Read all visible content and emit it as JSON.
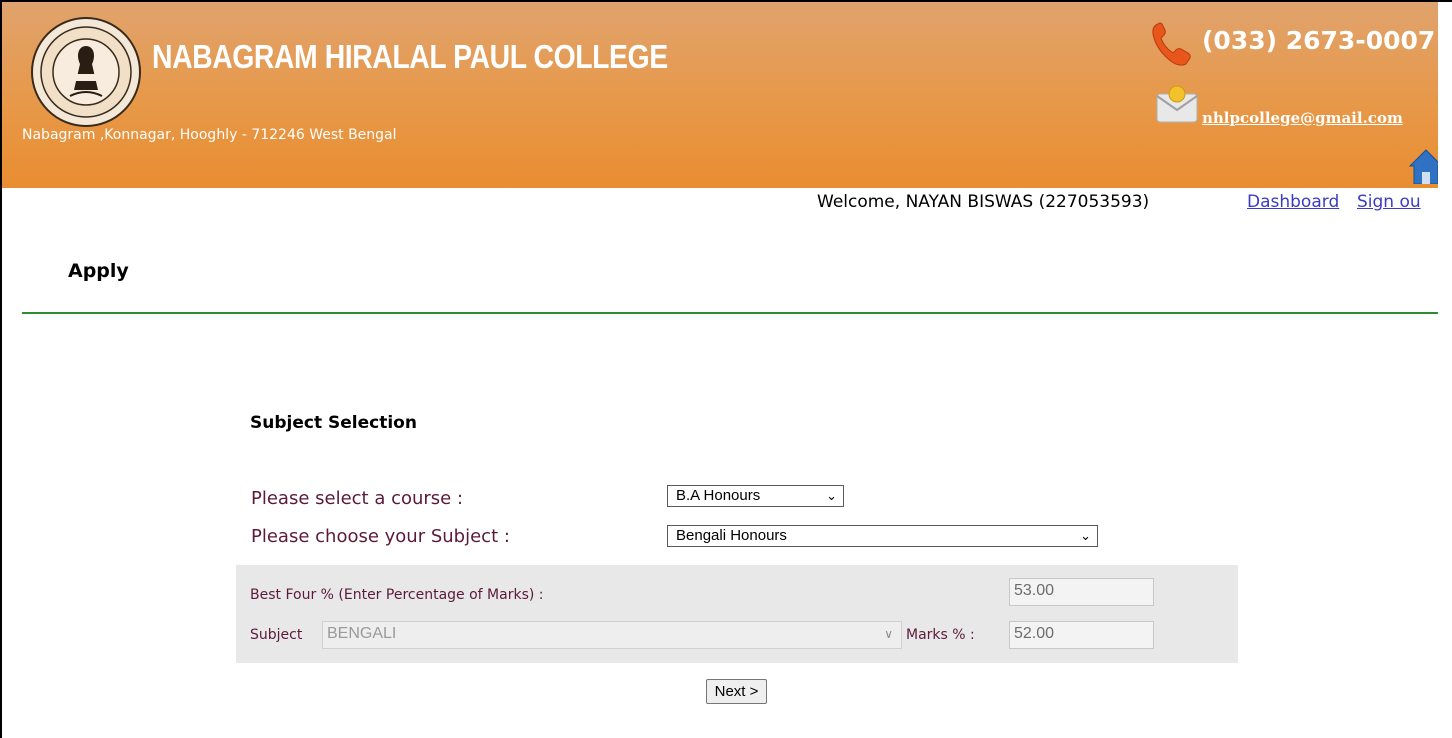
{
  "header": {
    "college_name": "NABAGRAM HIRALAL PAUL COLLEGE",
    "address": "Nabagram ,Konnagar, Hooghly - 712246 West Bengal",
    "phone": "(033) 2673-0007",
    "email": "nhlpcollege@gmail.com",
    "icons": [
      "college-logo",
      "phone-icon",
      "mail-icon",
      "home-icon"
    ],
    "gradient_top": "#e0a36d",
    "gradient_bottom": "#e98d31"
  },
  "user_bar": {
    "welcome": "Welcome, NAYAN BISWAS (227053593)",
    "dashboard_label": "Dashboard",
    "signout_label": "Sign ou"
  },
  "page": {
    "title": "Apply",
    "rule_color": "#2e8b2e"
  },
  "form": {
    "section_title": "Subject Selection",
    "course_label": "Please select a course :",
    "course_value": "B.A Honours",
    "subject_label": "Please choose your Subject :",
    "subject_value": "Bengali Honours",
    "best_four_label": "Best Four % (Enter Percentage of Marks) :",
    "best_four_value": "53.00",
    "subject_field_label": "Subject",
    "subject_field_value": "BENGALI",
    "marks_label": "Marks % :",
    "marks_value": "52.00",
    "next_label": "Next >"
  }
}
